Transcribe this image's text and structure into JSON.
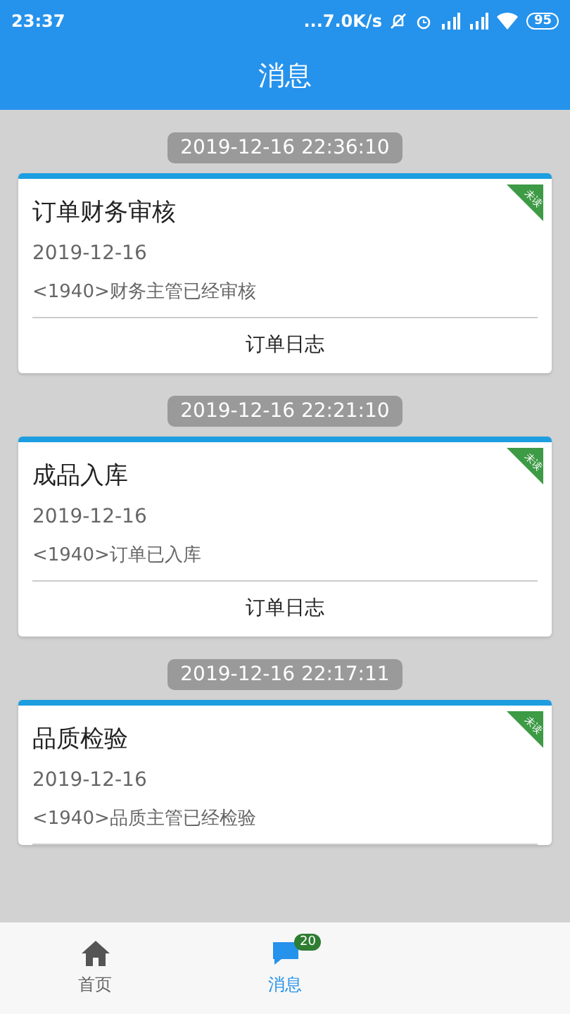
{
  "status_bar": {
    "time": "23:37",
    "net_speed": "...7.0K/s",
    "battery": "95"
  },
  "header": {
    "title": "消息"
  },
  "messages": [
    {
      "timestamp": "2019-12-16 22:36:10",
      "title": "订单财务审核",
      "date": "2019-12-16",
      "text": "<1940>财务主管已经审核",
      "unread": true,
      "unread_label": "未读",
      "action": "订单日志"
    },
    {
      "timestamp": "2019-12-16 22:21:10",
      "title": "成品入库",
      "date": "2019-12-16",
      "text": "<1940>订单已入库",
      "unread": true,
      "unread_label": "未读",
      "action": "订单日志"
    },
    {
      "timestamp": "2019-12-16 22:17:11",
      "title": "品质检验",
      "date": "2019-12-16",
      "text": "<1940>品质主管已经检验",
      "unread": true,
      "unread_label": "未读"
    }
  ],
  "bottom_nav": [
    {
      "label": "首页",
      "kind": "home",
      "selected": false
    },
    {
      "label": "消息",
      "kind": "messages",
      "selected": true,
      "badge": "20"
    }
  ]
}
